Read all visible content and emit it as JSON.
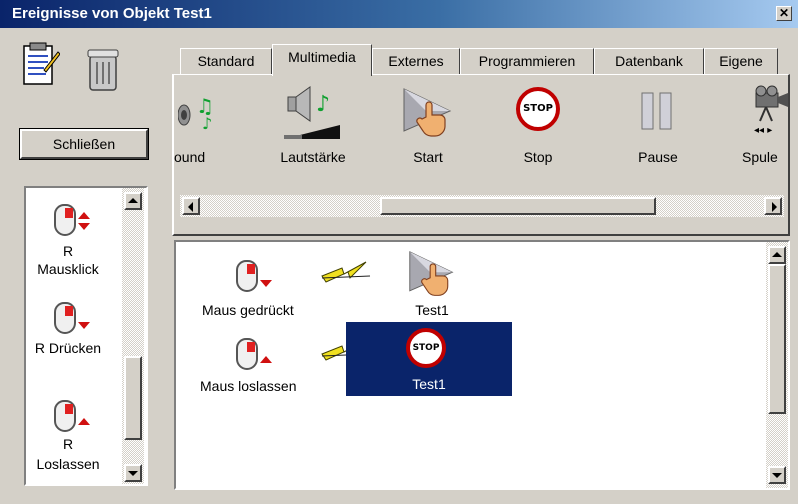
{
  "window": {
    "title": "Ereignisse von Objekt Test1",
    "close_glyph": "✕"
  },
  "toolbar": {
    "close_label": "Schließen"
  },
  "tabs": [
    "Standard",
    "Multimedia",
    "Externes",
    "Programmieren",
    "Datenbank",
    "Eigene"
  ],
  "active_tab": "Multimedia",
  "actions": [
    {
      "label": "ound",
      "icon": "sound-icon"
    },
    {
      "label": "Lautstärke",
      "icon": "volume-icon"
    },
    {
      "label": "Start",
      "icon": "play-icon"
    },
    {
      "label": "Stop",
      "icon": "stop-icon",
      "icon_text": "STOP"
    },
    {
      "label": "Pause",
      "icon": "pause-icon"
    },
    {
      "label": "Spule",
      "icon": "rewind-icon"
    }
  ],
  "triggers": [
    {
      "label": "R\nMausklick",
      "icon": "mouse-click-icon"
    },
    {
      "label": "R Drücken",
      "icon": "mouse-press-icon"
    },
    {
      "label": "R\nLoslassen",
      "icon": "mouse-release-icon"
    }
  ],
  "events": [
    {
      "trigger": "Maus gedrückt",
      "action_target": "Test1",
      "action_icon": "play-icon",
      "selected": false
    },
    {
      "trigger": "Maus loslassen",
      "action_target": "Test1",
      "action_icon": "stop-icon",
      "selected": true
    }
  ],
  "colors": {
    "selection": "#0a246a",
    "title_start": "#0a246a",
    "title_end": "#a6caf0",
    "stop_red": "#c00000",
    "lightning": "#f0e020"
  }
}
